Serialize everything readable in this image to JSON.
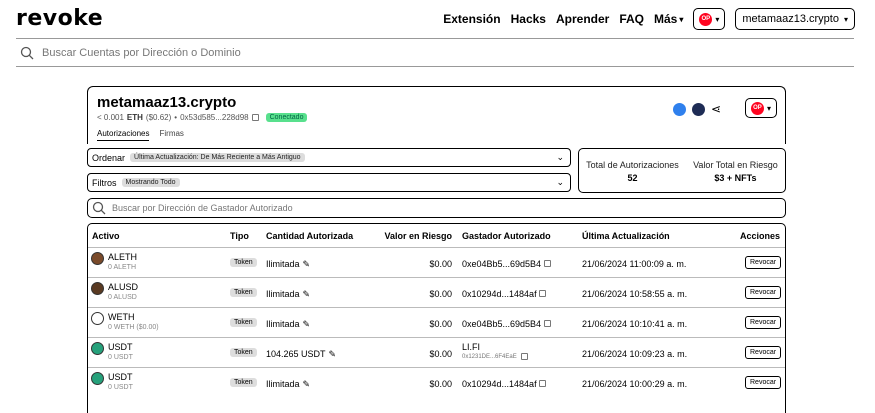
{
  "header": {
    "logo": "revoke",
    "nav": [
      "Extensión",
      "Hacks",
      "Aprender",
      "FAQ"
    ],
    "more_label": "Más",
    "chain_logo_text": "OP",
    "account_label": "metamaaz13.crypto"
  },
  "search": {
    "placeholder": "Buscar Cuentas por Dirección o Dominio"
  },
  "account": {
    "name": "metamaaz13.crypto",
    "balance": "< 0.001",
    "balance_unit": "ETH",
    "balance_usd": "($0.62)",
    "address": "0x53d585...228d98",
    "status": "Conectado",
    "tabs": [
      "Autorizaciones",
      "Firmas"
    ]
  },
  "filters": {
    "order_label": "Ordenar",
    "order_value": "Última Actualización: De Más Reciente a Más Antiguo",
    "filter_label": "Filtros",
    "filter_value": "Mostrando Todo"
  },
  "stats": {
    "total_label": "Total de Autorizaciones",
    "total_value": "52",
    "risk_label": "Valor Total en Riesgo",
    "risk_value": "$3 + NFTs"
  },
  "spender_search": {
    "placeholder": "Buscar por Dirección de Gastador Autorizado"
  },
  "table": {
    "headers": [
      "Activo",
      "Tipo",
      "Cantidad Autorizada",
      "Valor en Riesgo",
      "Gastador Autorizado",
      "Última Actualización",
      "Acciones"
    ],
    "rows": [
      {
        "asset": "ALETH",
        "balance": "0 ALETH",
        "type": "Token",
        "amount": "Ilimitada",
        "risk": "$0.00",
        "spender": "0xe04Bb5...69d5B4",
        "spender_sub": "",
        "updated": "21/06/2024 11:00:09 a. m.",
        "action": "Revocar",
        "icon_color": "#7a4a2a"
      },
      {
        "asset": "ALUSD",
        "balance": "0 ALUSD",
        "type": "Token",
        "amount": "Ilimitada",
        "risk": "$0.00",
        "spender": "0x10294d...1484af",
        "spender_sub": "",
        "updated": "21/06/2024 10:58:55 a. m.",
        "action": "Revocar",
        "icon_color": "#5a3a22"
      },
      {
        "asset": "WETH",
        "balance": "0 WETH ($0.00)",
        "type": "Token",
        "amount": "Ilimitada",
        "risk": "$0.00",
        "spender": "0xe04Bb5...69d5B4",
        "spender_sub": "",
        "updated": "21/06/2024 10:10:41 a. m.",
        "action": "Revocar",
        "icon_color": "#ffffff"
      },
      {
        "asset": "USDT",
        "balance": "0 USDT",
        "type": "Token",
        "amount": "104.265 USDT",
        "risk": "$0.00",
        "spender": "LI.FI",
        "spender_sub": "0x1231DE...6F4EaE",
        "updated": "21/06/2024 10:09:23 a. m.",
        "action": "Revocar",
        "icon_color": "#26a17b"
      },
      {
        "asset": "USDT",
        "balance": "0 USDT",
        "type": "Token",
        "amount": "Ilimitada",
        "risk": "$0.00",
        "spender": "0x10294d...1484af",
        "spender_sub": "",
        "updated": "21/06/2024 10:00:29 a. m.",
        "action": "Revocar",
        "icon_color": "#26a17b"
      }
    ]
  }
}
